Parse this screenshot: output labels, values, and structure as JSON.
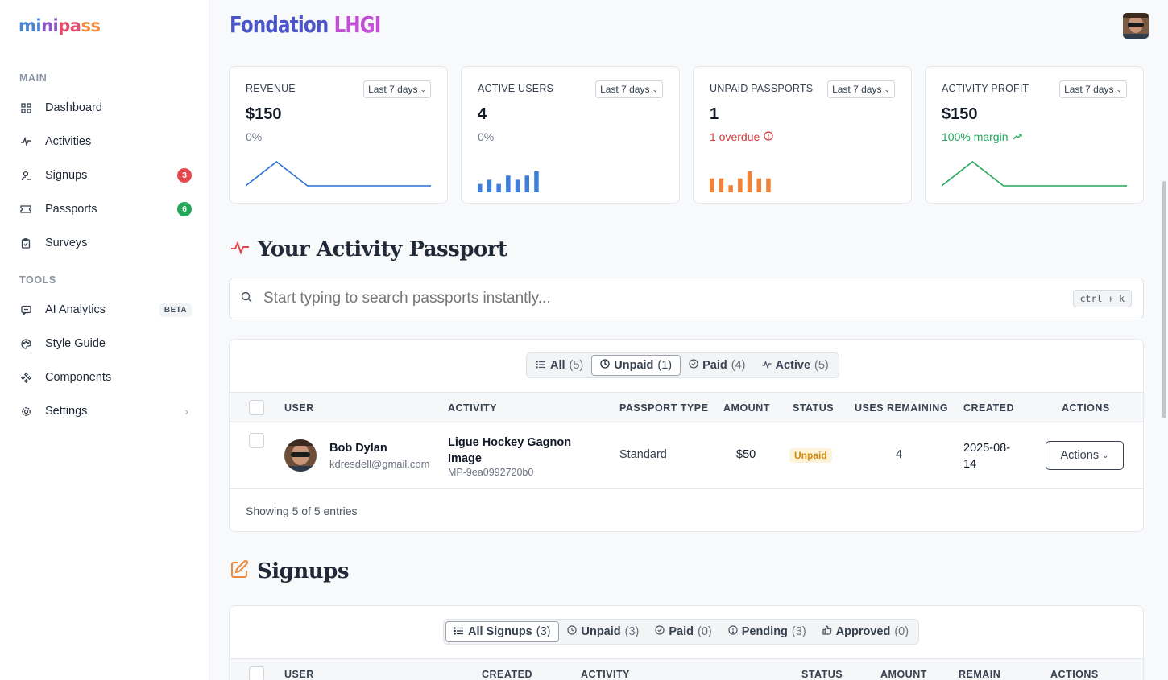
{
  "brand": {
    "logo": [
      "mi",
      "ni",
      "pa",
      "ss"
    ]
  },
  "header": {
    "org_title_part1": "Fondation",
    "org_title_part2": "LHGI"
  },
  "sidebar": {
    "sections": {
      "main": "MAIN",
      "tools": "TOOLS"
    },
    "items": [
      {
        "label": "Dashboard",
        "icon": "grid-icon"
      },
      {
        "label": "Activities",
        "icon": "activity-icon"
      },
      {
        "label": "Signups",
        "icon": "user-signup-icon",
        "badge": "3",
        "badge_color": "#e5484d"
      },
      {
        "label": "Passports",
        "icon": "ticket-icon",
        "badge": "6",
        "badge_color": "#22a65a"
      },
      {
        "label": "Surveys",
        "icon": "clipboard-icon"
      },
      {
        "label": "AI Analytics",
        "icon": "chat-icon",
        "pill": "BETA"
      },
      {
        "label": "Style Guide",
        "icon": "palette-icon"
      },
      {
        "label": "Components",
        "icon": "components-icon"
      },
      {
        "label": "Settings",
        "icon": "gear-icon"
      }
    ]
  },
  "kpis": [
    {
      "label": "REVENUE",
      "period": "Last 7 days",
      "value": "$150",
      "sub": "0%",
      "sub_color": "gray",
      "chart": {
        "type": "line",
        "color": "#2a6fd6",
        "values": [
          0,
          1,
          0,
          0,
          0,
          0,
          0
        ]
      }
    },
    {
      "label": "ACTIVE USERS",
      "period": "Last 7 days",
      "value": "4",
      "sub": "0%",
      "sub_color": "gray",
      "chart": {
        "type": "bar",
        "color": "#3d7fd9",
        "values": [
          2,
          3,
          2,
          4,
          3,
          4,
          5
        ]
      }
    },
    {
      "label": "UNPAID PASSPORTS",
      "period": "Last 7 days",
      "value": "1",
      "sub": "1 overdue",
      "sub_color": "red",
      "chart": {
        "type": "bar",
        "color": "#f0823a",
        "values": [
          2,
          2,
          1,
          2,
          3,
          2,
          2
        ]
      }
    },
    {
      "label": "ACTIVITY PROFIT",
      "period": "Last 7 days",
      "value": "$150",
      "sub": "100% margin",
      "sub_color": "green",
      "chart": {
        "type": "line",
        "color": "#22a65a",
        "values": [
          0,
          1,
          0,
          0,
          0,
          0,
          0
        ]
      }
    }
  ],
  "passport_section": {
    "title": "Your Activity Passport",
    "search_placeholder": "Start typing to search passports instantly...",
    "shortcut": "ctrl + k",
    "filters": [
      {
        "label": "All",
        "count": "(5)",
        "icon": "list-icon"
      },
      {
        "label": "Unpaid",
        "count": "(1)",
        "icon": "clock-icon",
        "active": true
      },
      {
        "label": "Paid",
        "count": "(4)",
        "icon": "check-circle-icon"
      },
      {
        "label": "Active",
        "count": "(5)",
        "icon": "activity-icon"
      }
    ],
    "columns": [
      "USER",
      "ACTIVITY",
      "PASSPORT TYPE",
      "AMOUNT",
      "STATUS",
      "USES REMAINING",
      "CREATED",
      "ACTIONS"
    ],
    "rows": [
      {
        "user_name": "Bob Dylan",
        "user_email": "kdresdell@gmail.com",
        "activity": "Ligue Hockey Gagnon Image",
        "passport_id": "MP-9ea0992720b0",
        "type": "Standard",
        "amount": "$50",
        "status": "Unpaid",
        "uses_remaining": "4",
        "created": "2025-08-14",
        "actions": "Actions"
      }
    ],
    "footer": "Showing 5 of 5 entries"
  },
  "signups_section": {
    "title": "Signups",
    "filters": [
      {
        "label": "All Signups",
        "count": "(3)",
        "icon": "list-icon",
        "active": true
      },
      {
        "label": "Unpaid",
        "count": "(3)",
        "icon": "clock-icon"
      },
      {
        "label": "Paid",
        "count": "(0)",
        "icon": "check-circle-icon"
      },
      {
        "label": "Pending",
        "count": "(3)",
        "icon": "alert-circle-icon"
      },
      {
        "label": "Approved",
        "count": "(0)",
        "icon": "thumbs-up-icon"
      }
    ],
    "columns": [
      "USER",
      "CREATED",
      "ACTIVITY",
      "STATUS",
      "AMOUNT",
      "REMAIN",
      "ACTIONS"
    ]
  }
}
